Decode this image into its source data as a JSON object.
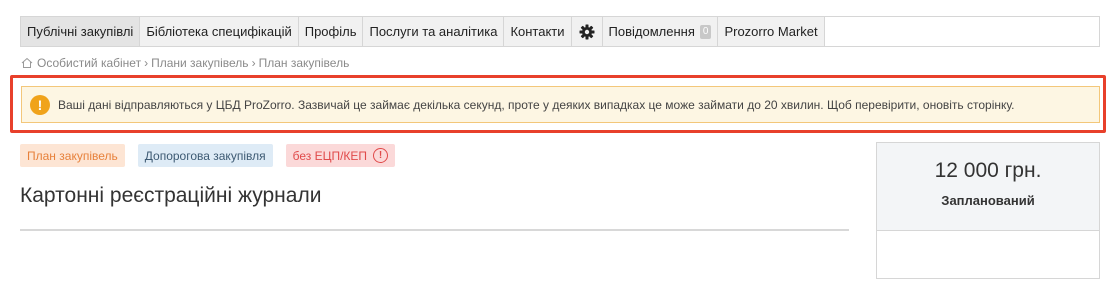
{
  "nav": {
    "items": [
      {
        "label": "Публічні закупівлі"
      },
      {
        "label": "Бібліотека специфікацій"
      },
      {
        "label": "Профіль"
      },
      {
        "label": "Послуги та аналітика"
      },
      {
        "label": "Контакти"
      },
      {
        "icon": "gear-icon"
      },
      {
        "label": "Повідомлення",
        "badge": "0"
      },
      {
        "label": "Prozorro Market"
      }
    ]
  },
  "breadcrumb": {
    "icon": "home-icon",
    "items": [
      "Особистий кабінет",
      "Плани закупівель",
      "План закупівель"
    ]
  },
  "alert": {
    "icon": "warning-icon",
    "text": "Ваші дані відправляються у ЦБД ProZorro. Зазвичай це займає декілька секунд, проте у деяких випадках це може займати до 20 хвилин. Щоб перевірити, оновіть сторінку.",
    "highlight_color": "#e8402b"
  },
  "tags": {
    "plan": "План закупівель",
    "type": "Допорогова закупівля",
    "signature": "без ЕЦП/КЕП"
  },
  "title": "Картонні реєстраційні журнали",
  "card": {
    "amount": "12 000 грн.",
    "status": "Запланований"
  }
}
